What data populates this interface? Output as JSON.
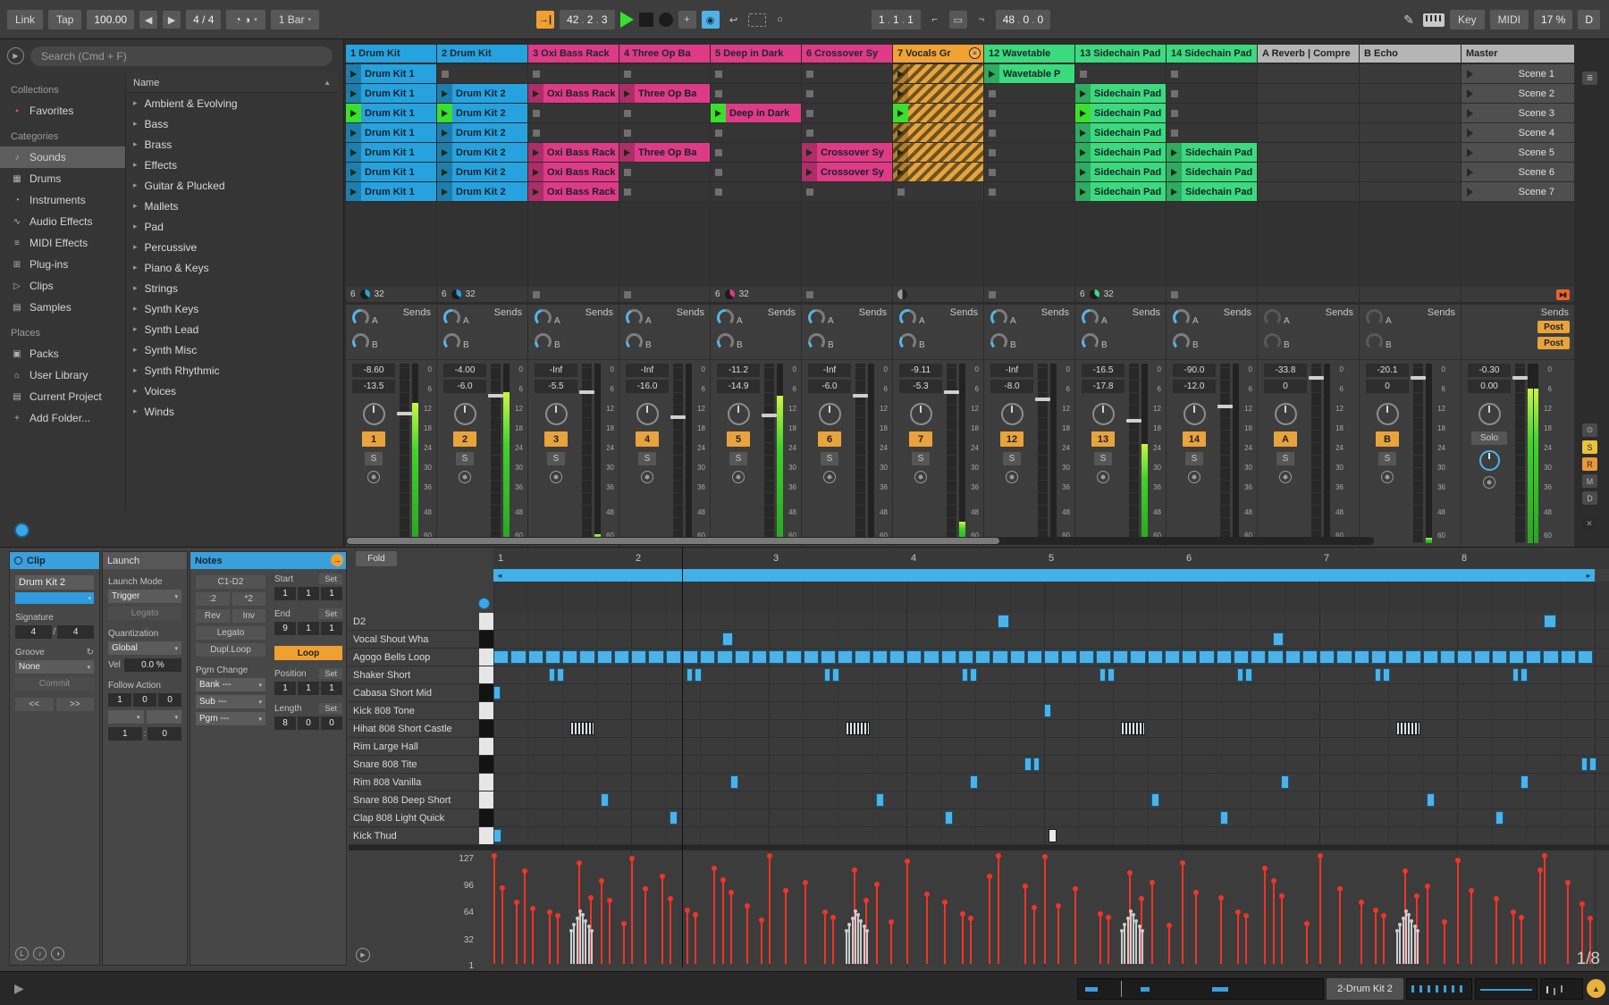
{
  "colors": {
    "blue": "#26a2de",
    "pink": "#de3a86",
    "orange": "#f0a232",
    "green": "#3bda7d",
    "play_green": "#3ae02e",
    "number_btn": "#e8a33d",
    "vel_red": "#f03428",
    "loop_blue": "#41b1ea",
    "return_gray": "#b5b5b5"
  },
  "transport": {
    "link": "Link",
    "tap": "Tap",
    "tempo": "100.00",
    "nudge_left": "◀",
    "nudge_right": "▶",
    "sig": "4 / 4",
    "metronome": "◔ ◑",
    "menu_arrow": "▾",
    "quantize": "1 Bar",
    "follow": "→|",
    "dot": ".",
    "pos": [
      "42",
      "2",
      "3"
    ],
    "plus": "+",
    "session_record": "◉",
    "capture": "↩",
    "new_btn": "○",
    "loop_start": [
      "1",
      "1",
      "1"
    ],
    "punch_in": "⌐",
    "loop_toggle": "▭",
    "punch_out": "¬",
    "loop_length": [
      "48",
      "0",
      "0"
    ],
    "draw": "✎",
    "key": "Key",
    "midi": "MIDI",
    "cpu": "17 %",
    "disk": "D"
  },
  "browser": {
    "search_placeholder": "Search (Cmd + F)",
    "preview_icon": "▶",
    "name_header": "Name",
    "sort_icon": "▲",
    "expand_icon": "▸",
    "sections": [
      {
        "label": "Collections",
        "items": [
          {
            "label": "Favorites",
            "icon": "▪",
            "icon_color": "#e05548"
          }
        ]
      },
      {
        "label": "Categories",
        "items": [
          {
            "label": "Sounds",
            "icon": "♪",
            "sel": 1
          },
          {
            "label": "Drums",
            "icon": "▦"
          },
          {
            "label": "Instruments",
            "icon": "◔"
          },
          {
            "label": "Audio Effects",
            "icon": "∿"
          },
          {
            "label": "MIDI Effects",
            "icon": "≡"
          },
          {
            "label": "Plug-ins",
            "icon": "⊞"
          },
          {
            "label": "Clips",
            "icon": "▷"
          },
          {
            "label": "Samples",
            "icon": "▤"
          }
        ]
      },
      {
        "label": "Places",
        "items": [
          {
            "label": "Packs",
            "icon": "▣"
          },
          {
            "label": "User Library",
            "icon": "⌂"
          },
          {
            "label": "Current Project",
            "icon": "▤"
          },
          {
            "label": "Add Folder...",
            "icon": "+"
          }
        ]
      }
    ],
    "list": [
      "Ambient & Evolving",
      "Bass",
      "Brass",
      "Effects",
      "Guitar & Plucked",
      "Mallets",
      "Pad",
      "Percussive",
      "Piano & Keys",
      "Strings",
      "Synth Keys",
      "Synth Lead",
      "Synth Misc",
      "Synth Rhythmic",
      "Voices",
      "Winds"
    ]
  },
  "session": {
    "sends_label": "Sends",
    "solo_label": "S",
    "stop_all": "▶▮",
    "scale": [
      "0",
      "6",
      "12",
      "18",
      "24",
      "30",
      "36",
      "48",
      "60"
    ],
    "scenes": [
      "Scene 1",
      "Scene 2",
      "Scene 3",
      "Scene 4",
      "Scene 5",
      "Scene 6",
      "Scene 7"
    ],
    "rail": {
      "top": "≣",
      "toggles": [
        "⊙",
        "S",
        "R",
        "M",
        "D"
      ],
      "toggle_colors": [
        "",
        "#e8c23a",
        "#e8973a",
        "",
        ""
      ],
      "close": "✕"
    },
    "tracks": [
      {
        "title": "1 Drum Kit",
        "kind": "track",
        "color": "blue",
        "clips": [
          {
            "l": "Drum Kit 1"
          },
          {
            "l": "Drum Kit 1"
          },
          {
            "l": "Drum Kit 1",
            "p": 1
          },
          {
            "l": "Drum Kit 1"
          },
          {
            "l": "Drum Kit 1"
          },
          {
            "l": "Drum Kit 1"
          },
          {
            "l": "Drum Kit 1"
          }
        ],
        "status": {
          "t": "count",
          "a": "6",
          "b": "32"
        },
        "peak": "-8.60",
        "vol": "-13.5",
        "num": "1",
        "meter": 0.78,
        "fader": 0.72,
        "sendA": 0.5,
        "sendB": 0.2
      },
      {
        "title": "2 Drum Kit",
        "kind": "track",
        "color": "blue",
        "clips": [
          null,
          {
            "l": "Drum Kit 2"
          },
          {
            "l": "Drum Kit 2",
            "p": 1
          },
          {
            "l": "Drum Kit 2"
          },
          {
            "l": "Drum Kit 2"
          },
          {
            "l": "Drum Kit 2"
          },
          {
            "l": "Drum Kit 2"
          }
        ],
        "status": {
          "t": "count",
          "a": "6",
          "b": "32"
        },
        "peak": "-4.00",
        "vol": "-6.0",
        "num": "2",
        "meter": 0.84,
        "fader": 0.82,
        "sendA": 0.5,
        "sendB": 0.2
      },
      {
        "title": "3 Oxi Bass Rack",
        "kind": "track",
        "color": "pink",
        "clips": [
          null,
          {
            "l": "Oxi Bass Rack"
          },
          null,
          null,
          {
            "l": "Oxi Bass Rack"
          },
          {
            "l": "Oxi Bass Rack"
          },
          {
            "l": "Oxi Bass Rack"
          }
        ],
        "status": {
          "t": "stop"
        },
        "peak": "-Inf",
        "vol": "-5.5",
        "num": "3",
        "meter": 0.05,
        "fader": 0.84,
        "sendA": 0.45,
        "sendB": 0.15
      },
      {
        "title": "4 Three Op Ba",
        "kind": "track",
        "color": "pink",
        "clips": [
          null,
          {
            "l": "Three Op Ba"
          },
          null,
          null,
          {
            "l": "Three Op Ba"
          },
          null,
          null
        ],
        "status": {
          "t": "stop"
        },
        "peak": "-Inf",
        "vol": "-16.0",
        "num": "4",
        "meter": 0,
        "fader": 0.7,
        "sendA": 0.4,
        "sendB": 0.15
      },
      {
        "title": "5 Deep in Dark",
        "kind": "track",
        "color": "pink",
        "clips": [
          null,
          null,
          {
            "l": "Deep in Dark",
            "p": 1
          },
          null,
          null,
          null,
          null
        ],
        "status": {
          "t": "count",
          "a": "6",
          "b": "32"
        },
        "peak": "-11.2",
        "vol": "-14.9",
        "num": "5",
        "meter": 0.82,
        "fader": 0.71,
        "sendA": 0.5,
        "sendB": 0.2
      },
      {
        "title": "6 Crossover Sy",
        "kind": "track",
        "color": "pink",
        "clips": [
          null,
          null,
          null,
          null,
          {
            "l": "Crossover Sy"
          },
          {
            "l": "Crossover Sy"
          },
          null
        ],
        "status": {
          "t": "stop"
        },
        "peak": "-Inf",
        "vol": "-6.0",
        "num": "6",
        "meter": 0,
        "fader": 0.82,
        "sendA": 0.45,
        "sendB": 0.15
      },
      {
        "title": "7 Vocals Gr",
        "kind": "track",
        "color": "orange",
        "group": 1,
        "clips": [
          {
            "h": 1
          },
          {
            "h": 1
          },
          {
            "h": 1,
            "p": 1
          },
          {
            "h": 1
          },
          {
            "h": 1
          },
          {
            "h": 1
          },
          null
        ],
        "status": {
          "t": "half"
        },
        "peak": "-9.11",
        "vol": "-5.3",
        "num": "7",
        "meter": 0.12,
        "fader": 0.84,
        "sendA": 0.55,
        "sendB": 0.3
      },
      {
        "title": "12 Wavetable",
        "kind": "track",
        "color": "green",
        "clips": [
          {
            "l": "Wavetable P"
          },
          null,
          null,
          null,
          null,
          null,
          null
        ],
        "status": {
          "t": "stop"
        },
        "peak": "-Inf",
        "vol": "-8.0",
        "num": "12",
        "meter": 0,
        "fader": 0.8,
        "sendA": 0.4,
        "sendB": 0.15
      },
      {
        "title": "13 Sidechain Pad",
        "kind": "track",
        "color": "green",
        "clips": [
          null,
          {
            "l": "Sidechain Pad"
          },
          {
            "l": "Sidechain Pad",
            "p": 1
          },
          {
            "l": "Sidechain Pad"
          },
          {
            "l": "Sidechain Pad"
          },
          {
            "l": "Sidechain Pad"
          },
          {
            "l": "Sidechain Pad"
          }
        ],
        "status": {
          "t": "count",
          "a": "6",
          "b": "32"
        },
        "peak": "-16.5",
        "vol": "-17.8",
        "num": "13",
        "meter": 0.55,
        "fader": 0.68,
        "sendA": 0.5,
        "sendB": 0.2
      },
      {
        "title": "14 Sidechain Pad",
        "kind": "track",
        "color": "green",
        "clips": [
          null,
          null,
          null,
          null,
          {
            "l": "Sidechain Pad"
          },
          {
            "l": "Sidechain Pad"
          },
          {
            "l": "Sidechain Pad"
          }
        ],
        "status": {
          "t": "stop"
        },
        "peak": "-90.0",
        "vol": "-12.0",
        "num": "14",
        "meter": 0,
        "fader": 0.76,
        "sendA": 0.4,
        "sendB": 0.15
      },
      {
        "title": "A Reverb | Compre",
        "kind": "return",
        "clips": [],
        "status": {
          "t": "none"
        },
        "peak": "-33.8",
        "vol": "0",
        "num": "A",
        "meter": 0,
        "fader": 0.92
      },
      {
        "title": "B Echo",
        "kind": "return",
        "clips": [],
        "status": {
          "t": "none"
        },
        "peak": "-20.1",
        "vol": "0",
        "num": "B",
        "meter": 0.03,
        "fader": 0.92
      },
      {
        "title": "Master",
        "kind": "master",
        "clips": [],
        "status": {
          "t": "stopall"
        },
        "peak": "-0.30",
        "vol": "0.00",
        "meter": 0.86,
        "fader": 0.92,
        "post_a": "Post",
        "post_b": "Post",
        "solo": "Solo"
      }
    ]
  },
  "clip_panel": {
    "tab_clip": "Clip",
    "tab_launch": "Launch",
    "tab_notes": "Notes",
    "arrow": "→",
    "dd_arrow": "▾",
    "groove_icon": "↻",
    "name": "Drum Kit 2",
    "signature_label": "Signature",
    "sig_a": "4",
    "sig_slash": "/",
    "sig_b": "4",
    "groove_label": "Groove",
    "groove_value": "None",
    "commit": "Commit",
    "nudge_back": "<<",
    "nudge_fwd": ">>",
    "launch_mode_label": "Launch Mode",
    "launch_mode": "Trigger",
    "legato": "Legato",
    "quantization_label": "Quantization",
    "quantization": "Global",
    "vel_label": "Vel",
    "vel_value": "0.0 %",
    "follow_action_label": "Follow Action",
    "fa_time": [
      "1",
      "0",
      "0"
    ],
    "fa_colon": ":",
    "fa_a": "1",
    "fa_b": "0",
    "notes_range": "C1-D2",
    "half": ":2",
    "double": "*2",
    "rev": "Rev",
    "inv": "Inv",
    "legato2": "Legato",
    "dupl_loop": "Dupl.Loop",
    "pgm_change_label": "Pgm Change",
    "bank": "Bank ---",
    "sub": "Sub ---",
    "pgm": "Pgm ---",
    "start_label": "Start",
    "end_label": "End",
    "position_label": "Position",
    "length_label": "Length",
    "set": "Set",
    "start": [
      "1",
      "1",
      "1"
    ],
    "end": [
      "9",
      "1",
      "1"
    ],
    "position": [
      "1",
      "1",
      "1"
    ],
    "length": [
      "8",
      "0",
      "0"
    ],
    "loop": "Loop",
    "bottom_icons": [
      "L",
      "♪",
      "◑"
    ]
  },
  "midi_editor": {
    "fold": "Fold",
    "bars": [
      "1",
      "2",
      "3",
      "4",
      "5",
      "6",
      "7",
      "8"
    ],
    "loop_left": "◄",
    "loop_right": "►",
    "lane_icon": "▶",
    "velocity_scale": [
      "127",
      "96",
      "64",
      "32",
      "1"
    ],
    "page": "1/8",
    "playhead_bar": 2.37,
    "rolls": [
      1.56,
      3.56,
      5.56,
      7.56
    ],
    "roll_velocities": [
      36,
      44,
      52,
      60,
      56,
      48,
      42,
      36
    ],
    "rows": [
      {
        "name": "D2",
        "key": "w",
        "notes": [
          [
            4.66,
            0.09
          ],
          [
            8.63,
            0.09
          ]
        ]
      },
      {
        "name": "Vocal Shout Wha",
        "key": "b",
        "notes": [
          [
            2.66,
            0.08
          ],
          [
            6.66,
            0.08
          ]
        ]
      },
      {
        "name": "Agogo Bells Loop",
        "key": "w",
        "pattern": "eighths"
      },
      {
        "name": "Shaker Short",
        "key": "w",
        "notes": [
          [
            1.4,
            0.05
          ],
          [
            1.46,
            0.05
          ],
          [
            2.4,
            0.05
          ],
          [
            2.46,
            0.05
          ],
          [
            3.4,
            0.05
          ],
          [
            3.46,
            0.05
          ],
          [
            4.4,
            0.05
          ],
          [
            4.46,
            0.05
          ],
          [
            5.4,
            0.05
          ],
          [
            5.46,
            0.05
          ],
          [
            6.4,
            0.05
          ],
          [
            6.46,
            0.05
          ],
          [
            7.4,
            0.05
          ],
          [
            7.46,
            0.05
          ],
          [
            8.4,
            0.05
          ],
          [
            8.46,
            0.05
          ]
        ]
      },
      {
        "name": "Cabasa Short Mid",
        "key": "b",
        "notes": [
          [
            1.0,
            0.05
          ]
        ]
      },
      {
        "name": "Kick 808 Tone",
        "key": "w",
        "notes": [
          [
            5.0,
            0.05
          ]
        ]
      },
      {
        "name": "Hihat 808 Short Castle",
        "key": "b",
        "use_rolls": true,
        "notes": []
      },
      {
        "name": "Rim Large Hall",
        "key": "w",
        "notes": []
      },
      {
        "name": "Snare 808 Tite",
        "key": "b",
        "notes": [
          [
            4.86,
            0.05
          ],
          [
            4.92,
            0.05
          ],
          [
            8.9,
            0.05
          ],
          [
            8.96,
            0.05
          ]
        ]
      },
      {
        "name": "Rim 808 Vanilla",
        "key": "w",
        "notes": [
          [
            2.72,
            0.06
          ],
          [
            4.46,
            0.06
          ],
          [
            6.72,
            0.06
          ],
          [
            8.46,
            0.06
          ]
        ]
      },
      {
        "name": "Snare 808 Deep Short",
        "key": "w",
        "notes": [
          [
            1.78,
            0.06
          ],
          [
            3.78,
            0.06
          ],
          [
            5.78,
            0.06
          ],
          [
            7.78,
            0.06
          ]
        ]
      },
      {
        "name": "Clap 808 Light Quick",
        "key": "b",
        "notes": [
          [
            2.28,
            0.06
          ],
          [
            4.28,
            0.06
          ],
          [
            6.28,
            0.06
          ],
          [
            8.28,
            0.06
          ]
        ]
      },
      {
        "name": "Kick Thud",
        "key": "w",
        "notes": [
          [
            1.0,
            0.06
          ],
          [
            5.03,
            0.06,
            1
          ]
        ]
      }
    ],
    "velocities": [
      [
        1.0,
        127
      ],
      [
        1.06,
        88
      ],
      [
        1.16,
        70
      ],
      [
        1.22,
        108
      ],
      [
        1.28,
        62
      ],
      [
        1.4,
        58
      ],
      [
        1.46,
        54
      ],
      [
        1.62,
        118
      ],
      [
        1.7,
        76
      ],
      [
        1.78,
        96
      ],
      [
        1.84,
        72
      ],
      [
        1.94,
        44
      ],
      [
        2.0,
        124
      ],
      [
        2.1,
        86
      ],
      [
        2.22,
        102
      ],
      [
        2.28,
        74
      ],
      [
        2.4,
        60
      ],
      [
        2.46,
        55
      ],
      [
        2.6,
        112
      ],
      [
        2.66,
        98
      ],
      [
        2.72,
        82
      ],
      [
        2.84,
        66
      ],
      [
        2.94,
        48
      ],
      [
        3.0,
        127
      ],
      [
        3.12,
        84
      ],
      [
        3.26,
        94
      ],
      [
        3.4,
        58
      ],
      [
        3.46,
        52
      ],
      [
        3.62,
        110
      ],
      [
        3.7,
        72
      ],
      [
        3.78,
        92
      ],
      [
        3.88,
        46
      ],
      [
        4.0,
        120
      ],
      [
        4.14,
        80
      ],
      [
        4.27,
        70
      ],
      [
        4.4,
        56
      ],
      [
        4.46,
        50
      ],
      [
        4.6,
        102
      ],
      [
        4.66,
        127
      ],
      [
        4.86,
        90
      ],
      [
        4.92,
        64
      ],
      [
        5.0,
        126
      ],
      [
        5.1,
        66
      ],
      [
        5.22,
        86
      ],
      [
        5.4,
        56
      ],
      [
        5.46,
        52
      ],
      [
        5.62,
        106
      ],
      [
        5.7,
        74
      ],
      [
        5.78,
        94
      ],
      [
        5.9,
        42
      ],
      [
        6.0,
        118
      ],
      [
        6.1,
        82
      ],
      [
        6.28,
        76
      ],
      [
        6.4,
        58
      ],
      [
        6.46,
        54
      ],
      [
        6.6,
        112
      ],
      [
        6.66,
        96
      ],
      [
        6.72,
        78
      ],
      [
        6.9,
        44
      ],
      [
        7.0,
        127
      ],
      [
        7.14,
        86
      ],
      [
        7.3,
        70
      ],
      [
        7.4,
        60
      ],
      [
        7.46,
        54
      ],
      [
        7.62,
        108
      ],
      [
        7.7,
        78
      ],
      [
        7.78,
        90
      ],
      [
        7.9,
        46
      ],
      [
        8.0,
        122
      ],
      [
        8.1,
        84
      ],
      [
        8.28,
        74
      ],
      [
        8.4,
        58
      ],
      [
        8.46,
        52
      ],
      [
        8.6,
        110
      ],
      [
        8.63,
        127
      ],
      [
        8.8,
        94
      ],
      [
        8.9,
        68
      ],
      [
        8.96,
        50
      ]
    ]
  },
  "status_bar": {
    "clip_label": "2-Drum Kit 2",
    "play_icon": "▶",
    "circle_icon": "▲"
  }
}
